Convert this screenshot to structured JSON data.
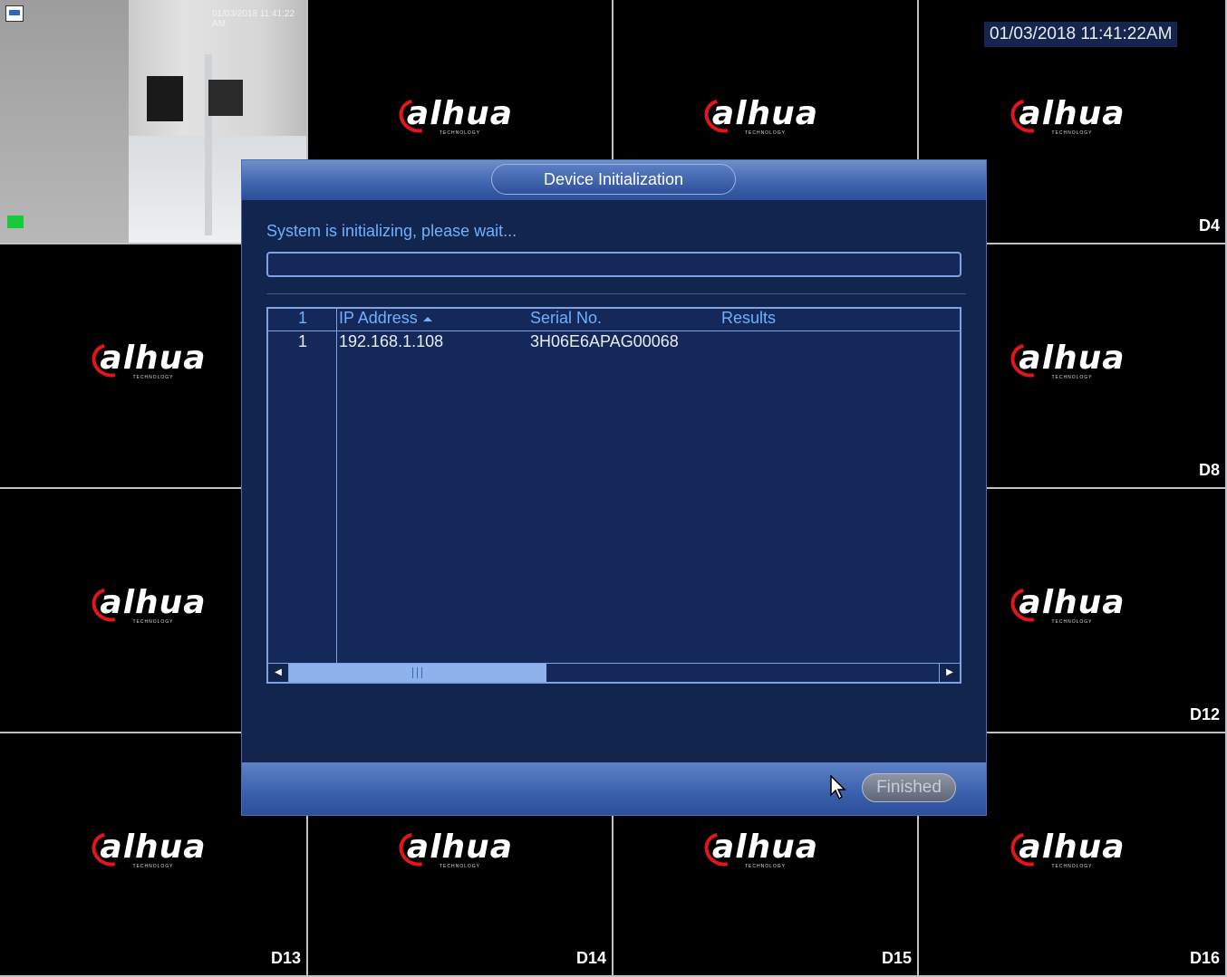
{
  "clock": "01/03/2018 11:41:22AM",
  "feed": {
    "timestamp": "01/03/2018 11:41:22 AM"
  },
  "logo": {
    "brand": "alhua",
    "tagline": "TECHNOLOGY"
  },
  "cells": [
    {
      "label": ""
    },
    {
      "label": ""
    },
    {
      "label": ""
    },
    {
      "label": "D4"
    },
    {
      "label": ""
    },
    {
      "label": ""
    },
    {
      "label": ""
    },
    {
      "label": "D8"
    },
    {
      "label": ""
    },
    {
      "label": ""
    },
    {
      "label": ""
    },
    {
      "label": "D12"
    },
    {
      "label": "D13"
    },
    {
      "label": "D14"
    },
    {
      "label": "D15"
    },
    {
      "label": "D16"
    }
  ],
  "dialog": {
    "title": "Device Initialization",
    "status": "System is initializing, please wait...",
    "progress": 0,
    "table": {
      "headers": {
        "num": "1",
        "ip": "IP Address",
        "serial": "Serial No.",
        "results": "Results"
      },
      "rows": [
        {
          "num": "1",
          "ip": "192.168.1.108",
          "serial": "3H06E6APAG00068",
          "results": ""
        }
      ]
    },
    "finished_label": "Finished"
  },
  "colors": {
    "accent": "#6fb1ff",
    "panel": "#12254f",
    "logo_red": "#e0161b"
  }
}
